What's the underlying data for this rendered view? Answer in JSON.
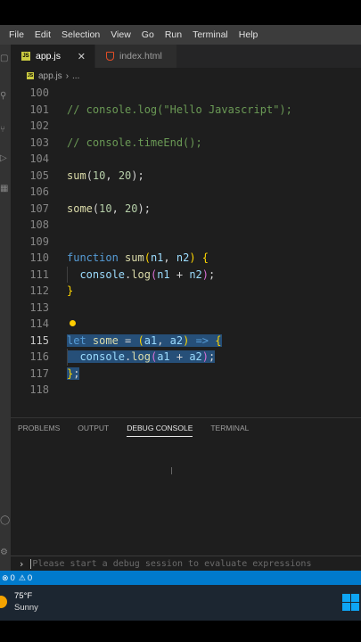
{
  "menu": [
    "File",
    "Edit",
    "Selection",
    "View",
    "Go",
    "Run",
    "Terminal",
    "Help"
  ],
  "tabs": [
    {
      "label": "app.js",
      "active": true
    },
    {
      "label": "index.html",
      "active": false
    }
  ],
  "breadcrumb": {
    "file": "app.js",
    "more": "..."
  },
  "editor": {
    "lines": [
      {
        "n": "100",
        "tokens": []
      },
      {
        "n": "101",
        "tokens": [
          {
            "t": "// console.log(\"Hello Javascript\");",
            "c": "comment"
          }
        ]
      },
      {
        "n": "102",
        "tokens": []
      },
      {
        "n": "103",
        "tokens": [
          {
            "t": "// console.timeEnd();",
            "c": "comment"
          }
        ]
      },
      {
        "n": "104",
        "tokens": []
      },
      {
        "n": "105",
        "tokens": [
          {
            "t": "sum",
            "c": "fn"
          },
          {
            "t": "(",
            "c": "punc"
          },
          {
            "t": "10",
            "c": "num"
          },
          {
            "t": ", ",
            "c": "punc"
          },
          {
            "t": "20",
            "c": "num"
          },
          {
            "t": ");",
            "c": "punc"
          }
        ]
      },
      {
        "n": "106",
        "tokens": []
      },
      {
        "n": "107",
        "tokens": [
          {
            "t": "some",
            "c": "fn"
          },
          {
            "t": "(",
            "c": "punc"
          },
          {
            "t": "10",
            "c": "num"
          },
          {
            "t": ", ",
            "c": "punc"
          },
          {
            "t": "20",
            "c": "num"
          },
          {
            "t": ");",
            "c": "punc"
          }
        ]
      },
      {
        "n": "108",
        "tokens": []
      },
      {
        "n": "109",
        "tokens": []
      },
      {
        "n": "110",
        "tokens": [
          {
            "t": "function",
            "c": "kw"
          },
          {
            "t": " ",
            "c": "punc"
          },
          {
            "t": "sum",
            "c": "fn"
          },
          {
            "t": "(",
            "c": "brace"
          },
          {
            "t": "n1",
            "c": "var"
          },
          {
            "t": ", ",
            "c": "punc"
          },
          {
            "t": "n2",
            "c": "var"
          },
          {
            "t": ")",
            "c": "brace"
          },
          {
            "t": " ",
            "c": "punc"
          },
          {
            "t": "{",
            "c": "brace"
          }
        ]
      },
      {
        "n": "111",
        "tokens": [
          {
            "t": "  ",
            "c": "punc"
          },
          {
            "t": "console",
            "c": "var"
          },
          {
            "t": ".",
            "c": "punc"
          },
          {
            "t": "log",
            "c": "fn"
          },
          {
            "t": "(",
            "c": "paren"
          },
          {
            "t": "n1",
            "c": "var"
          },
          {
            "t": " + ",
            "c": "punc"
          },
          {
            "t": "n2",
            "c": "var"
          },
          {
            "t": ")",
            "c": "paren"
          },
          {
            "t": ";",
            "c": "punc"
          }
        ]
      },
      {
        "n": "112",
        "tokens": [
          {
            "t": "}",
            "c": "brace"
          }
        ]
      },
      {
        "n": "113",
        "tokens": []
      },
      {
        "n": "114",
        "tokens": [],
        "bulb": true
      },
      {
        "n": "115",
        "current": true,
        "selected": true,
        "tokens": [
          {
            "t": "let",
            "c": "kw"
          },
          {
            "t": " ",
            "c": "punc"
          },
          {
            "t": "some",
            "c": "fn"
          },
          {
            "t": " = ",
            "c": "punc"
          },
          {
            "t": "(",
            "c": "brace"
          },
          {
            "t": "a1",
            "c": "var"
          },
          {
            "t": ", ",
            "c": "punc"
          },
          {
            "t": "a2",
            "c": "var"
          },
          {
            "t": ")",
            "c": "brace"
          },
          {
            "t": " ",
            "c": "punc"
          },
          {
            "t": "=>",
            "c": "kw"
          },
          {
            "t": " ",
            "c": "punc"
          },
          {
            "t": "{",
            "c": "brace"
          }
        ]
      },
      {
        "n": "116",
        "selected": true,
        "tokens": [
          {
            "t": "  ",
            "c": "punc"
          },
          {
            "t": "console",
            "c": "var"
          },
          {
            "t": ".",
            "c": "punc"
          },
          {
            "t": "log",
            "c": "fn"
          },
          {
            "t": "(",
            "c": "paren"
          },
          {
            "t": "a1",
            "c": "var"
          },
          {
            "t": " + ",
            "c": "punc"
          },
          {
            "t": "a2",
            "c": "var"
          },
          {
            "t": ")",
            "c": "paren"
          },
          {
            "t": ";",
            "c": "punc"
          }
        ]
      },
      {
        "n": "117",
        "selected": true,
        "tokens": [
          {
            "t": "}",
            "c": "brace"
          },
          {
            "t": ";",
            "c": "punc"
          }
        ]
      },
      {
        "n": "118",
        "tokens": []
      }
    ]
  },
  "panel": {
    "tabs": [
      {
        "label": "PROBLEMS",
        "active": false
      },
      {
        "label": "OUTPUT",
        "active": false
      },
      {
        "label": "DEBUG CONSOLE",
        "active": true
      },
      {
        "label": "TERMINAL",
        "active": false
      }
    ],
    "debug_placeholder": "Please start a debug session to evaluate expressions"
  },
  "status": {
    "errors": "0",
    "warnings": "0"
  },
  "taskbar": {
    "temp": "75°F",
    "condition": "Sunny"
  },
  "colors": {
    "accent": "#007acc",
    "editor_bg": "#1e1e1e",
    "selection": "#264f78"
  }
}
